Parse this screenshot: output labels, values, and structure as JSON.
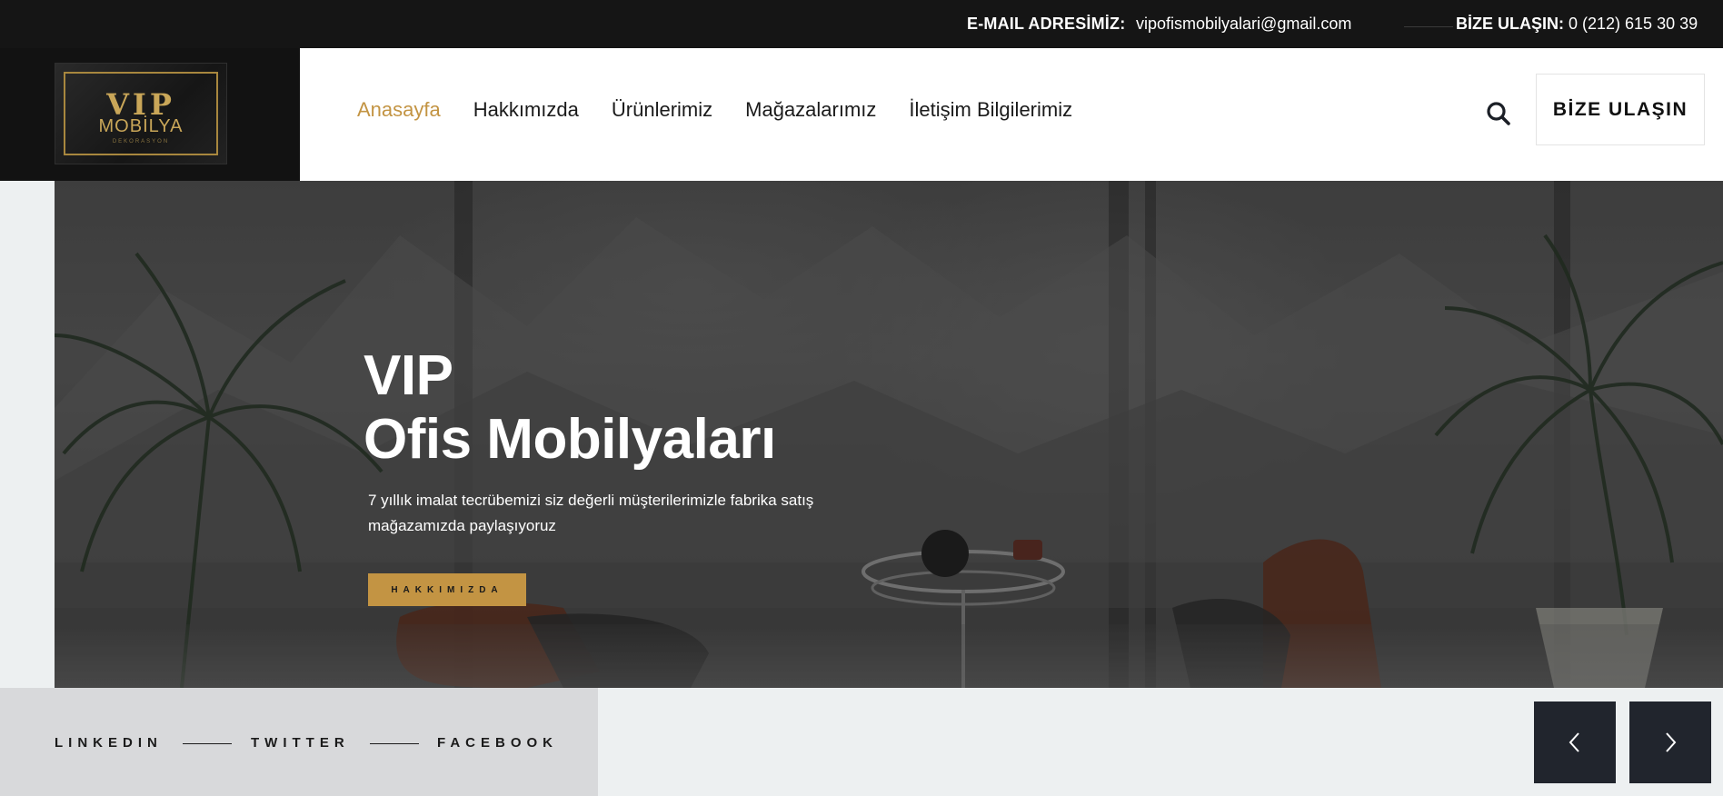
{
  "topbar": {
    "email_label": "E-MAIL ADRESİMİZ:",
    "email_value": "vipofismobilyalari@gmail.com",
    "phone_label": "BİZE ULAŞIN:",
    "phone_value": "0 (212) 615 30 39"
  },
  "logo": {
    "line1": "VIP",
    "line2": "MOBİLYA",
    "line3": "DEKORASYON"
  },
  "nav": {
    "items": [
      {
        "label": "Anasayfa",
        "active": true
      },
      {
        "label": "Hakkımızda"
      },
      {
        "label": "Ürünlerimiz"
      },
      {
        "label": "Mağazalarımız"
      },
      {
        "label": "İletişim Bilgilerimiz"
      }
    ],
    "search_icon": "search-icon",
    "cta_label": "BİZE ULAŞIN",
    "accent_color": "#c39443"
  },
  "hero": {
    "title_line1": "VIP",
    "title_line2": "Ofis Mobilyaları",
    "text": "7 yıllık imalat tecrübemizi siz değerli müşterilerimizle fabrika satış mağazamızda paylaşıyoruz",
    "button_label": "HAKKIMIZDA"
  },
  "social": {
    "items": [
      "LINKEDIN",
      "TWITTER",
      "FACEBOOK"
    ]
  },
  "slider": {
    "prev_icon": "chevron-left-icon",
    "next_icon": "chevron-right-icon"
  }
}
